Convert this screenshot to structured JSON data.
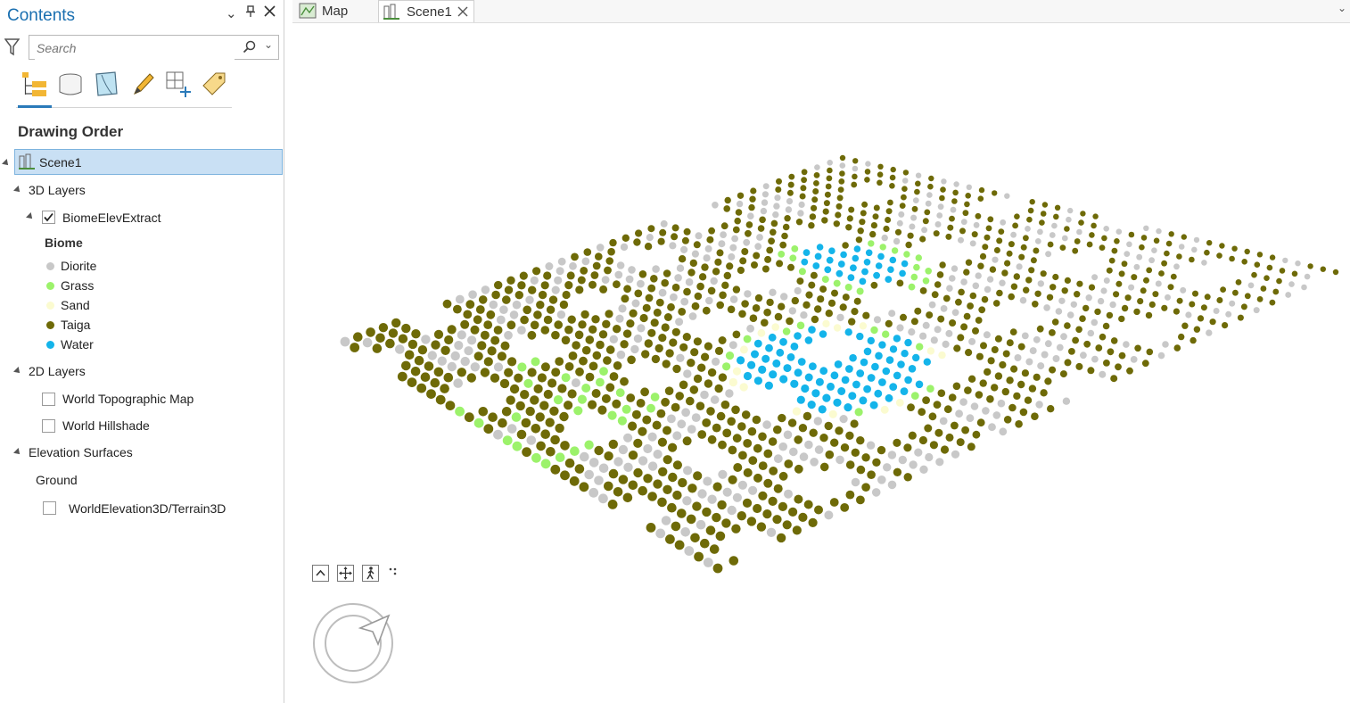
{
  "contents_pane": {
    "title": "Contents",
    "search_placeholder": "Search",
    "tools": [
      {
        "name": "list-by-drawing-order-icon"
      },
      {
        "name": "list-by-data-source-icon"
      },
      {
        "name": "list-by-selection-icon"
      },
      {
        "name": "list-by-editing-icon"
      },
      {
        "name": "list-by-snapping-icon"
      },
      {
        "name": "list-by-labeling-icon"
      }
    ],
    "section_title": "Drawing Order",
    "scene_name": "Scene1",
    "layers_3d_label": "3D Layers",
    "layer_name": "BiomeElevExtract",
    "layer_checked": true,
    "legend_field": "Biome",
    "legend": [
      {
        "label": "Diorite",
        "color": "#c8c8c8"
      },
      {
        "label": "Grass",
        "color": "#9cf26b"
      },
      {
        "label": "Sand",
        "color": "#fbfbd0"
      },
      {
        "label": "Taiga",
        "color": "#6e6a07"
      },
      {
        "label": "Water",
        "color": "#14b4ea"
      }
    ],
    "layers_2d_label": "2D Layers",
    "layers_2d": [
      {
        "label": "World Topographic Map",
        "checked": false
      },
      {
        "label": "World Hillshade",
        "checked": false
      }
    ],
    "elevation_label": "Elevation Surfaces",
    "ground_label": "Ground",
    "elevation_source": "WorldElevation3D/Terrain3D",
    "elevation_checked": false
  },
  "view_tabs": [
    {
      "label": "Map",
      "icon": "map-view-icon",
      "active": false
    },
    {
      "label": "Scene1",
      "icon": "scene-view-icon",
      "active": true
    }
  ],
  "accent_color": "#1a6fb0"
}
